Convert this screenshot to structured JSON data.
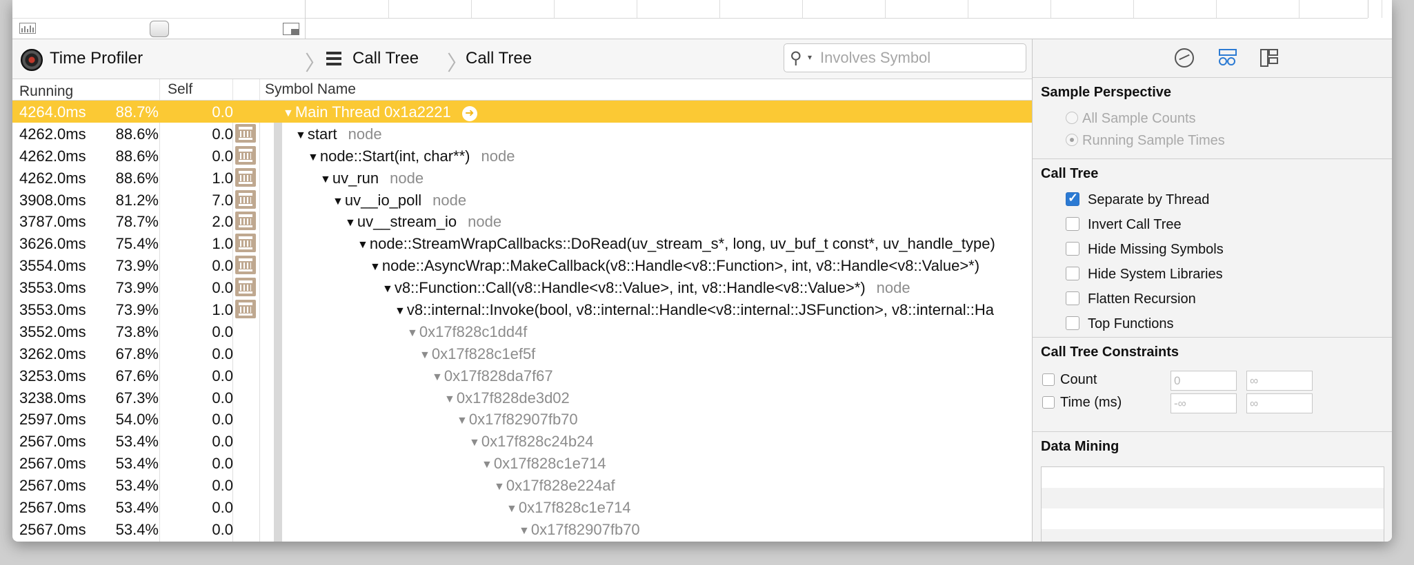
{
  "jumpbar": {
    "instrument": "Time Profiler",
    "crumb1": "Call Tree",
    "crumb2": "Call Tree",
    "search_placeholder": "Involves Symbol"
  },
  "columns": {
    "running_time": "Running Time",
    "self": "Self",
    "symbol": "Symbol Name"
  },
  "rows": [
    {
      "time": "4264.0ms",
      "pct": "88.7%",
      "self": "0.0",
      "symbol": "Main Thread  0x1a2221",
      "lib": "",
      "indent": 0,
      "selected": true,
      "userlib": false,
      "addr": false,
      "goto": true
    },
    {
      "time": "4262.0ms",
      "pct": "88.6%",
      "self": "0.0",
      "symbol": "start",
      "lib": "node",
      "indent": 1,
      "userlib": true
    },
    {
      "time": "4262.0ms",
      "pct": "88.6%",
      "self": "0.0",
      "symbol": "node::Start(int, char**)",
      "lib": "node",
      "indent": 2,
      "userlib": true
    },
    {
      "time": "4262.0ms",
      "pct": "88.6%",
      "self": "1.0",
      "symbol": "uv_run",
      "lib": "node",
      "indent": 3,
      "userlib": true
    },
    {
      "time": "3908.0ms",
      "pct": "81.2%",
      "self": "7.0",
      "symbol": "uv__io_poll",
      "lib": "node",
      "indent": 4,
      "userlib": true
    },
    {
      "time": "3787.0ms",
      "pct": "78.7%",
      "self": "2.0",
      "symbol": "uv__stream_io",
      "lib": "node",
      "indent": 5,
      "userlib": true
    },
    {
      "time": "3626.0ms",
      "pct": "75.4%",
      "self": "1.0",
      "symbol": "node::StreamWrapCallbacks::DoRead(uv_stream_s*, long, uv_buf_t const*, uv_handle_type)",
      "lib": "",
      "indent": 6,
      "userlib": true
    },
    {
      "time": "3554.0ms",
      "pct": "73.9%",
      "self": "0.0",
      "symbol": "node::AsyncWrap::MakeCallback(v8::Handle<v8::Function>, int, v8::Handle<v8::Value>*)",
      "lib": "",
      "indent": 7,
      "userlib": true
    },
    {
      "time": "3553.0ms",
      "pct": "73.9%",
      "self": "0.0",
      "symbol": "v8::Function::Call(v8::Handle<v8::Value>, int, v8::Handle<v8::Value>*)",
      "lib": "node",
      "indent": 8,
      "userlib": true
    },
    {
      "time": "3553.0ms",
      "pct": "73.9%",
      "self": "1.0",
      "symbol": "v8::internal::Invoke(bool, v8::internal::Handle<v8::internal::JSFunction>, v8::internal::Ha",
      "lib": "",
      "indent": 9,
      "userlib": true
    },
    {
      "time": "3552.0ms",
      "pct": "73.8%",
      "self": "0.0",
      "symbol": "0x17f828c1dd4f",
      "lib": "",
      "indent": 10,
      "addr": true
    },
    {
      "time": "3262.0ms",
      "pct": "67.8%",
      "self": "0.0",
      "symbol": "0x17f828c1ef5f",
      "lib": "",
      "indent": 11,
      "addr": true
    },
    {
      "time": "3253.0ms",
      "pct": "67.6%",
      "self": "0.0",
      "symbol": "0x17f828da7f67",
      "lib": "",
      "indent": 12,
      "addr": true
    },
    {
      "time": "3238.0ms",
      "pct": "67.3%",
      "self": "0.0",
      "symbol": "0x17f828de3d02",
      "lib": "",
      "indent": 13,
      "addr": true
    },
    {
      "time": "2597.0ms",
      "pct": "54.0%",
      "self": "0.0",
      "symbol": "0x17f82907fb70",
      "lib": "",
      "indent": 14,
      "addr": true
    },
    {
      "time": "2567.0ms",
      "pct": "53.4%",
      "self": "0.0",
      "symbol": "0x17f828c24b24",
      "lib": "",
      "indent": 15,
      "addr": true
    },
    {
      "time": "2567.0ms",
      "pct": "53.4%",
      "self": "0.0",
      "symbol": "0x17f828c1e714",
      "lib": "",
      "indent": 16,
      "addr": true
    },
    {
      "time": "2567.0ms",
      "pct": "53.4%",
      "self": "0.0",
      "symbol": "0x17f828e224af",
      "lib": "",
      "indent": 17,
      "addr": true
    },
    {
      "time": "2567.0ms",
      "pct": "53.4%",
      "self": "0.0",
      "symbol": "0x17f828c1e714",
      "lib": "",
      "indent": 18,
      "addr": true
    },
    {
      "time": "2567.0ms",
      "pct": "53.4%",
      "self": "0.0",
      "symbol": "0x17f82907fb70",
      "lib": "",
      "indent": 19,
      "addr": true
    }
  ],
  "inspector": {
    "sample_perspective": {
      "title": "Sample Perspective",
      "options": [
        {
          "label": "All Sample Counts",
          "selected": false
        },
        {
          "label": "Running Sample Times",
          "selected": true
        }
      ]
    },
    "call_tree": {
      "title": "Call Tree",
      "options": [
        {
          "label": "Separate by Thread",
          "checked": true
        },
        {
          "label": "Invert Call Tree",
          "checked": false
        },
        {
          "label": "Hide Missing Symbols",
          "checked": false
        },
        {
          "label": "Hide System Libraries",
          "checked": false
        },
        {
          "label": "Flatten Recursion",
          "checked": false
        },
        {
          "label": "Top Functions",
          "checked": false
        }
      ]
    },
    "constraints": {
      "title": "Call Tree Constraints",
      "count_label": "Count",
      "count_min": "0",
      "count_max": "∞",
      "time_label": "Time (ms)",
      "time_min": "-∞",
      "time_max": "∞"
    },
    "data_mining": {
      "title": "Data Mining"
    }
  },
  "colors": {
    "selection": "#fbc934",
    "accent": "#2b7ad3",
    "library_badge": "#bfa890"
  },
  "icons": {
    "instrument": "time-profiler-icon",
    "list": "list-icon",
    "search": "search-icon",
    "library": "library-icon",
    "goto": "arrow-right-icon"
  }
}
